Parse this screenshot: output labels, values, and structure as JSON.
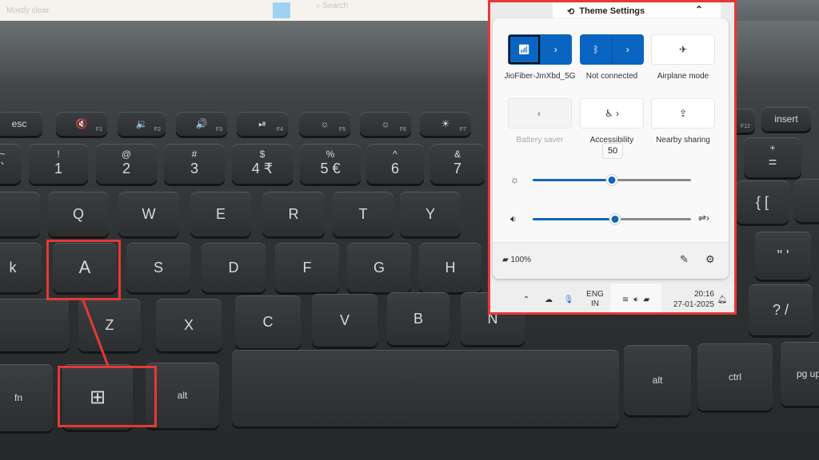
{
  "desktop": {
    "weather": "Mostly clear",
    "search_placeholder": "Search"
  },
  "keyboard": {
    "row1": [
      {
        "label": "esc"
      },
      {
        "label": "🔇",
        "fn": "F1"
      },
      {
        "label": "🔉",
        "fn": "F2"
      },
      {
        "label": "🔊",
        "fn": "F3"
      },
      {
        "label": "⏯",
        "fn": "F4"
      },
      {
        "label": "☼",
        "fn": "F5"
      },
      {
        "label": "☼",
        "fn": "F6"
      },
      {
        "label": "☀",
        "fn": "F7"
      },
      {
        "label": "",
        "fn": "F12"
      },
      {
        "label": "insert"
      }
    ],
    "row2": [
      {
        "top": "~",
        "bot": "`"
      },
      {
        "top": "!",
        "bot": "1"
      },
      {
        "top": "@",
        "bot": "2"
      },
      {
        "top": "#",
        "bot": "3"
      },
      {
        "top": "$",
        "bot": "4 ₹"
      },
      {
        "top": "%",
        "bot": "5 €"
      },
      {
        "top": "^",
        "bot": "6"
      },
      {
        "top": "&",
        "bot": "7"
      },
      {
        "top": "+",
        "bot": "="
      }
    ],
    "row3": [
      "",
      "Q",
      "W",
      "E",
      "R",
      "T",
      "Y",
      "{ [",
      ""
    ],
    "row4": [
      "k",
      "A",
      "S",
      "D",
      "F",
      "G",
      "H",
      "\" '"
    ],
    "row5": [
      "",
      "Z",
      "X",
      "C",
      "V",
      "B",
      "N",
      "? /"
    ],
    "row6": [
      "fn",
      "⊞",
      "alt",
      "",
      "alt",
      "ctrl",
      "pg up"
    ]
  },
  "theme_bar": {
    "title": "Theme Settings",
    "icon": "theme-icon"
  },
  "quick_settings": {
    "tiles": [
      {
        "label": "JioFiber-JmXbd_5G",
        "icon": "wifi-icon",
        "state": "on"
      },
      {
        "label": "Not connected",
        "icon": "bluetooth-icon",
        "state": "on"
      },
      {
        "label": "Airplane mode",
        "icon": "airplane-icon",
        "state": "off"
      },
      {
        "label": "Battery saver",
        "icon": "battery-saver-icon",
        "state": "disabled"
      },
      {
        "label": "Accessibility",
        "icon": "accessibility-icon",
        "state": "off"
      },
      {
        "label": "Nearby sharing",
        "icon": "share-icon",
        "state": "off"
      }
    ],
    "brightness": {
      "value": 50,
      "tooltip": "50"
    },
    "volume": {
      "value": 52
    },
    "battery": "100%",
    "accent": "#0a64c2"
  },
  "taskbar": {
    "lang": "ENG",
    "region": "IN",
    "time": "20:16",
    "date": "27-01-2025"
  }
}
